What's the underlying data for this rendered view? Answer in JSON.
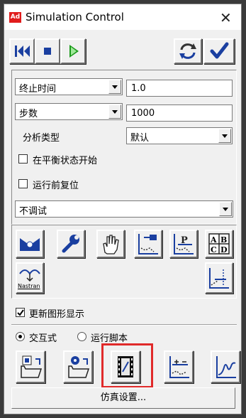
{
  "window": {
    "title": "Simulation Control",
    "app_icon_text": "Ad",
    "close_glyph": "✕"
  },
  "toolbar": {
    "buttons": [
      "rewind-icon",
      "stop-icon",
      "play-icon",
      "refresh-icon",
      "apply-check-icon"
    ]
  },
  "settings": {
    "end_mode": {
      "selected": "终止时间",
      "value": "1.0"
    },
    "steps_mode": {
      "selected": "步数",
      "value": "1000"
    },
    "analysis_type": {
      "label": "分析类型",
      "selected": "默认"
    },
    "start_at_equilibrium": {
      "label": "在平衡状态开始",
      "checked": false
    },
    "reset_before_run": {
      "label": "运行前复位",
      "checked": false
    },
    "debug": {
      "selected": "不调试"
    }
  },
  "tools": {
    "row1": [
      "measure-icon",
      "wrench-icon",
      "hand-icon",
      "plot-export-icon",
      "plot-p-icon",
      "abcd-table-icon"
    ],
    "row2_left": {
      "icon": "nastran-icon",
      "label": "Nastran"
    },
    "row2_right": "plot-eigen-icon"
  },
  "update_graphics": {
    "label": "更新图形显示",
    "checked": true
  },
  "mode": {
    "interactive": {
      "label": "交互式",
      "selected": true
    },
    "script": {
      "label": "运行脚本",
      "selected": false
    }
  },
  "bottom_tools": [
    "open-folder-icon",
    "open-settings-folder-icon",
    "film-icon",
    "plot-pm-icon",
    "curve-icon"
  ],
  "sim_settings_button": {
    "label": "仿真设置..."
  },
  "colors": {
    "highlight": "#e02a2a",
    "play_green": "#1a9a1a",
    "nav_blue": "#1a3fa0"
  }
}
